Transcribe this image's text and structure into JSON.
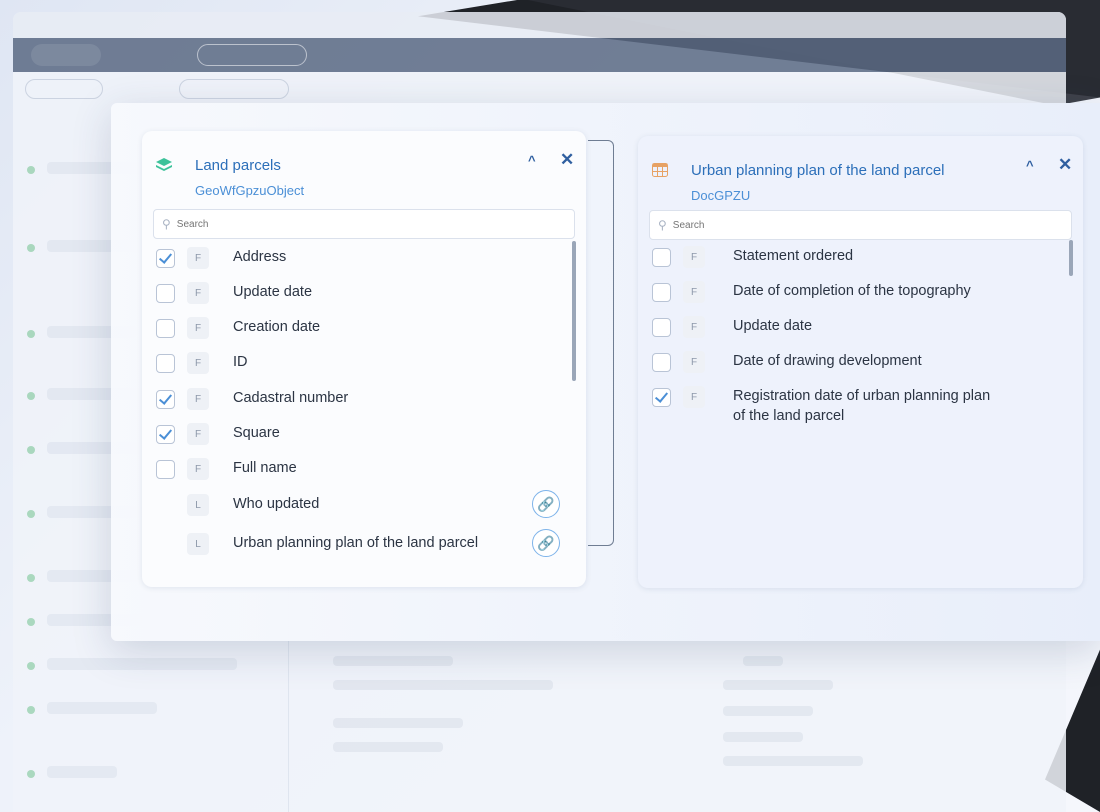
{
  "left_panel": {
    "title": "Land parcels",
    "subtitle": "GeoWfGpzuObject",
    "icon": "layers-icon",
    "search_placeholder": "Search",
    "collapse_icon": "^",
    "close_icon": "✕",
    "rows": [
      {
        "label": "Address",
        "type": "F",
        "checked": true
      },
      {
        "label": "Update date",
        "type": "F",
        "checked": false
      },
      {
        "label": "Creation date",
        "type": "F",
        "checked": false
      },
      {
        "label": "ID",
        "type": "F",
        "checked": false
      },
      {
        "label": "Cadastral number",
        "type": "F",
        "checked": true
      },
      {
        "label": "Square",
        "type": "F",
        "checked": true
      },
      {
        "label": "Full name",
        "type": "F",
        "checked": false
      },
      {
        "label": "Who updated",
        "type": "L",
        "link": true
      },
      {
        "label": "Urban planning plan of the land parcel",
        "type": "L",
        "link": true
      }
    ]
  },
  "right_panel": {
    "title": "Urban planning plan of the land parcel",
    "subtitle": "DocGPZU",
    "icon": "table-icon",
    "search_placeholder": "Search",
    "collapse_icon": "^",
    "close_icon": "✕",
    "rows": [
      {
        "label": "Statement ordered",
        "type": "F",
        "checked": false
      },
      {
        "label": "Date of completion of the topography",
        "type": "F",
        "checked": false
      },
      {
        "label": "Update date",
        "type": "F",
        "checked": false
      },
      {
        "label": "Date of drawing development",
        "type": "F",
        "checked": false
      },
      {
        "label": "Registration date of urban planning plan\nof the land parcel",
        "type": "F",
        "checked": true
      }
    ]
  },
  "colors": {
    "accent": "#2c6fb9",
    "toolbar": "#5b6a84",
    "green": "#3cc29a",
    "orange": "#e7a264"
  }
}
